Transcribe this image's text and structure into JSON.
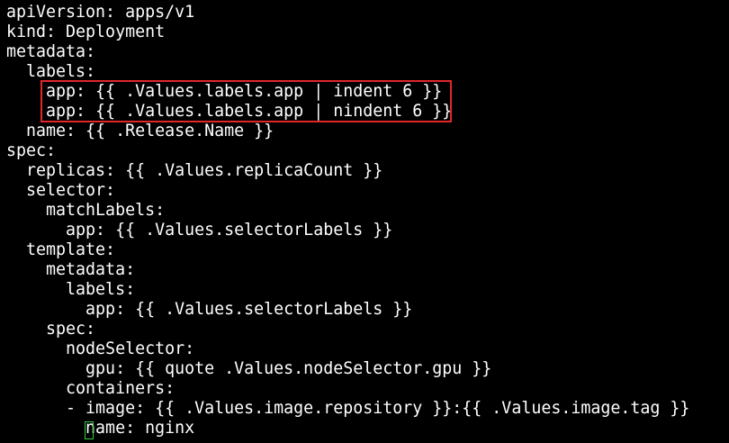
{
  "terminal": {
    "lines": [
      "apiVersion: apps/v1",
      "kind: Deployment",
      "metadata:",
      "  labels:",
      "    app: {{ .Values.labels.app | indent 6 }}",
      "    app: {{ .Values.labels.app | nindent 6 }}",
      "  name: {{ .Release.Name }}",
      "spec:",
      "  replicas: {{ .Values.replicaCount }}",
      "  selector:",
      "    matchLabels:",
      "      app: {{ .Values.selectorLabels }}",
      "  template:",
      "    metadata:",
      "      labels:",
      "        app: {{ .Values.selectorLabels }}",
      "    spec:",
      "      nodeSelector:",
      "        gpu: {{ quote .Values.nodeSelector.gpu }}",
      "      containers:",
      "      - image: {{ .Values.image.repository }}:{{ .Values.image.tag }}",
      "        name: nginx"
    ]
  },
  "colors": {
    "background": "#000000",
    "text": "#ffffff",
    "highlight_border": "#e0262b",
    "cursor_border": "#2ecc40"
  }
}
